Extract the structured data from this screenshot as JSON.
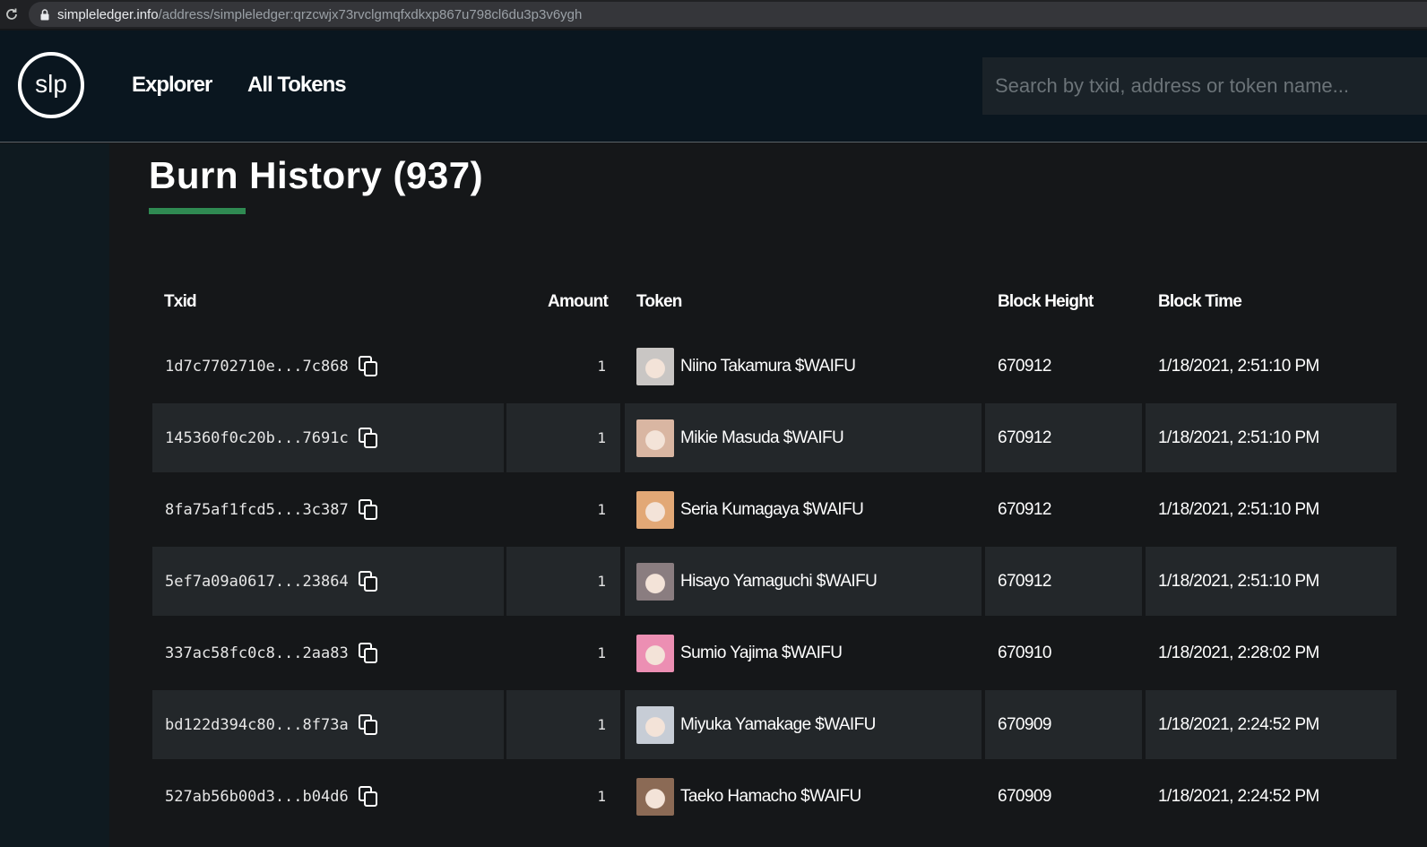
{
  "browser": {
    "url_host": "simpleledger.info",
    "url_path": "/address/simpleledger:qrzcwjx73rvclgmqfxdkxp867u798cl6du3p3v6ygh"
  },
  "header": {
    "logo_text": "slp",
    "nav": [
      "Explorer",
      "All Tokens"
    ],
    "search_placeholder": "Search by txid, address or token name..."
  },
  "page": {
    "title": "Burn History (937)"
  },
  "table": {
    "columns": [
      "Txid",
      "Amount",
      "Token",
      "Block Height",
      "Block Time"
    ],
    "rows": [
      {
        "txid": "1d7c7702710e...7c868",
        "amount": "1",
        "token": "Niino Takamura $WAIFU",
        "height": "670912",
        "time": "1/18/2021, 2:51:10 PM",
        "avatar_color": "#c9c6c4"
      },
      {
        "txid": "145360f0c20b...7691c",
        "amount": "1",
        "token": "Mikie Masuda $WAIFU",
        "height": "670912",
        "time": "1/18/2021, 2:51:10 PM",
        "avatar_color": "#d9b6a2"
      },
      {
        "txid": "8fa75af1fcd5...3c387",
        "amount": "1",
        "token": "Seria Kumagaya $WAIFU",
        "height": "670912",
        "time": "1/18/2021, 2:51:10 PM",
        "avatar_color": "#e2a876"
      },
      {
        "txid": "5ef7a09a0617...23864",
        "amount": "1",
        "token": "Hisayo Yamaguchi $WAIFU",
        "height": "670912",
        "time": "1/18/2021, 2:51:10 PM",
        "avatar_color": "#8a7d80"
      },
      {
        "txid": "337ac58fc0c8...2aa83",
        "amount": "1",
        "token": "Sumio Yajima $WAIFU",
        "height": "670910",
        "time": "1/18/2021, 2:28:02 PM",
        "avatar_color": "#ec8fb3"
      },
      {
        "txid": "bd122d394c80...8f73a",
        "amount": "1",
        "token": "Miyuka Yamakage $WAIFU",
        "height": "670909",
        "time": "1/18/2021, 2:24:52 PM",
        "avatar_color": "#c7cdd6"
      },
      {
        "txid": "527ab56b00d3...b04d6",
        "amount": "1",
        "token": "Taeko Hamacho $WAIFU",
        "height": "670909",
        "time": "1/18/2021, 2:24:52 PM",
        "avatar_color": "#8b6a55"
      }
    ]
  },
  "icons": {
    "reload": "reload-icon",
    "lock": "lock-icon",
    "copy": "copy-icon"
  },
  "colors": {
    "accent": "#2f8a52",
    "header_bg": "#0a161f",
    "page_bg": "#151719",
    "row_alt_bg": "#23272a"
  }
}
